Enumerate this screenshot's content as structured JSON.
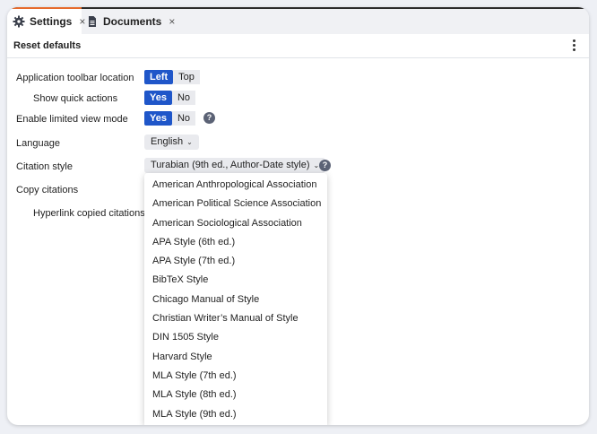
{
  "tabs": [
    {
      "label": "Settings",
      "icon": "gear-icon",
      "active": true
    },
    {
      "label": "Documents",
      "icon": "document-icon",
      "active": false
    }
  ],
  "toolbar": {
    "reset_label": "Reset defaults",
    "more_icon": "more-vertical-icon"
  },
  "settings": {
    "toolbar_location": {
      "label": "Application toolbar location",
      "options": [
        "Left",
        "Top"
      ],
      "selected": "Left"
    },
    "quick_actions": {
      "label": "Show quick actions",
      "options": [
        "Yes",
        "No"
      ],
      "selected": "Yes"
    },
    "limited_view": {
      "label": "Enable limited view mode",
      "options": [
        "Yes",
        "No"
      ],
      "selected": "Yes"
    },
    "language": {
      "label": "Language",
      "value": "English"
    },
    "citation_style": {
      "label": "Citation style",
      "value": "Turabian (9th ed., Author-Date style)"
    },
    "copy_citations": {
      "label": "Copy citations"
    },
    "hyperlink": {
      "label": "Hyperlink copied citations"
    }
  },
  "citation_options": [
    "American Anthropological Association",
    "American Political Science Association",
    "American Sociological Association",
    "APA Style (6th ed.)",
    "APA Style (7th ed.)",
    "BibTeX Style",
    "Chicago Manual of Style",
    "Christian Writer’s Manual of Style",
    "DIN 1505 Style",
    "Harvard Style",
    "MLA Style (7th ed.)",
    "MLA Style (8th ed.)",
    "MLA Style (9th ed.)"
  ],
  "help_glyph": "?",
  "close_glyph": "×",
  "colors": {
    "accent": "#1f56c9",
    "tab_highlight": "#e66a2c"
  }
}
